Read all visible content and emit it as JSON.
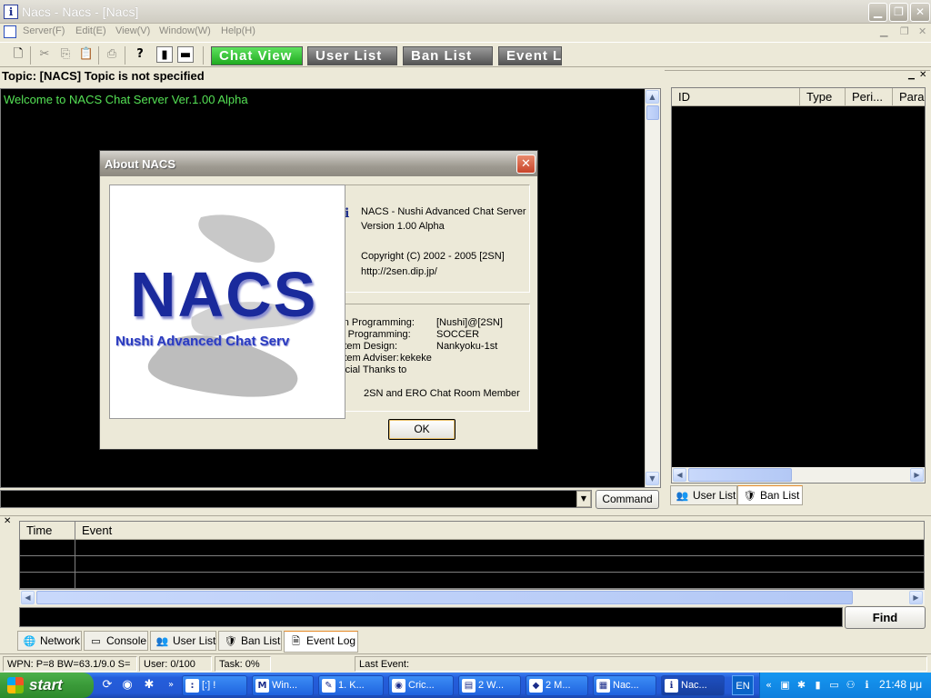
{
  "window": {
    "title": "Nacs - Nacs - [Nacs]",
    "app_icon": "nacs-app-icon"
  },
  "menu": [
    "Server(F)",
    "Edit(E)",
    "View(V)",
    "Window(W)",
    "Help(H)"
  ],
  "toolbar": {
    "icons": [
      "new-icon",
      "cut-icon",
      "copy-icon",
      "paste-icon",
      "print-icon",
      "help-icon",
      "view-a-icon",
      "view-b-icon"
    ],
    "views": [
      "Chat View",
      "User List",
      "Ban List",
      "Event L"
    ]
  },
  "topic": "Topic: [NACS] Topic is not specified",
  "chat": {
    "welcome": "Welcome to NACS Chat Server Ver.1.00 Alpha",
    "command_button": "Command"
  },
  "right_panel": {
    "columns": [
      "ID",
      "Type",
      "Peri...",
      "Para"
    ],
    "tabs": [
      "User List",
      "Ban List"
    ]
  },
  "event_log": {
    "columns": [
      "Time",
      "Event"
    ],
    "find_button": "Find"
  },
  "bottom_tabs": [
    "Network",
    "Console",
    "User List",
    "Ban List",
    "Event Log"
  ],
  "status": {
    "wpn": "WPN:  P=8 BW=63.1/9.0 S=",
    "user": "User:  0/100",
    "task": "Task:  0%",
    "last_event": "Last Event:"
  },
  "taskbar": {
    "start": "start",
    "tasks": [
      "[:] !",
      "Win...",
      "1. K...",
      "Cric...",
      "2 W...",
      "2 M...",
      "Nac...",
      "Nac..."
    ],
    "lang": "EN",
    "clock": "21:48 μμ"
  },
  "about": {
    "title": "About NACS",
    "logo_big": "NACS",
    "logo_small": "Nushi Advanced Chat Serv",
    "line1": "NACS - Nushi Advanced Chat Server",
    "line2": "Version 1.00 Alpha",
    "line3": "Copyright (C) 2002 - 2005  [2SN]",
    "line4": "http://2sen.dip.jp/",
    "credits": [
      {
        "role": "Main Programming:",
        "name": "[Nushi]@[2SN]"
      },
      {
        "role": "Sub Programming:",
        "name": "SOCCER"
      },
      {
        "role": "System Design:",
        "name": "Nankyoku-1st"
      },
      {
        "role": "System Adviser:",
        "name": "kekeke"
      },
      {
        "role": "Special Thanks to",
        "name": ""
      }
    ],
    "thanks": "2SN and ERO Chat Room Member",
    "ok": "OK"
  }
}
